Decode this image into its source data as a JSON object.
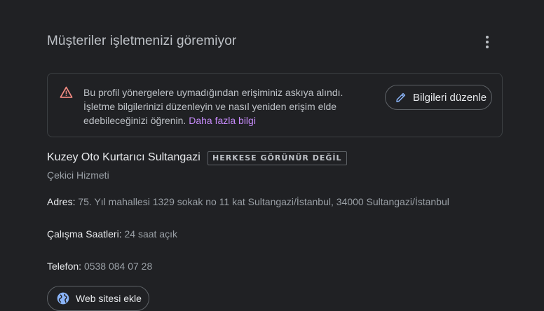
{
  "header": {
    "title": "Müşteriler işletmenizi göremiyor",
    "more_icon": "more-vert-icon"
  },
  "alert": {
    "icon": "warning-icon",
    "message": "Bu profil yönergelere uymadığından erişiminiz askıya alındı. İşletme bilgilerinizi düzenleyin ve nasıl yeniden erişim elde edebileceğinizi öğrenin.",
    "link_text": "Daha fazla bilgi",
    "edit_button_label": "Bilgileri düzenle",
    "edit_icon": "pencil-icon"
  },
  "business": {
    "name": "Kuzey Oto Kurtarıcı Sultangazi",
    "visibility_badge": "HERKESE GÖRÜNÜR DEĞİL",
    "category": "Çekici Hizmeti",
    "address_label": "Adres:",
    "address_value": "75. Yıl mahallesi 1329 sokak no 11 kat Sultangazi/İstanbul, 34000 Sultangazi/İstanbul",
    "hours_label": "Çalışma Saatleri:",
    "hours_value": "24 saat açık",
    "phone_label": "Telefon:",
    "phone_value": "0538 084 07 28",
    "website_button_label": "Web sitesi ekle",
    "website_icon": "globe-icon"
  },
  "colors": {
    "background": "#202124",
    "warning": "#f28b82",
    "link": "#c58af9",
    "accent": "#8ab4f8"
  }
}
